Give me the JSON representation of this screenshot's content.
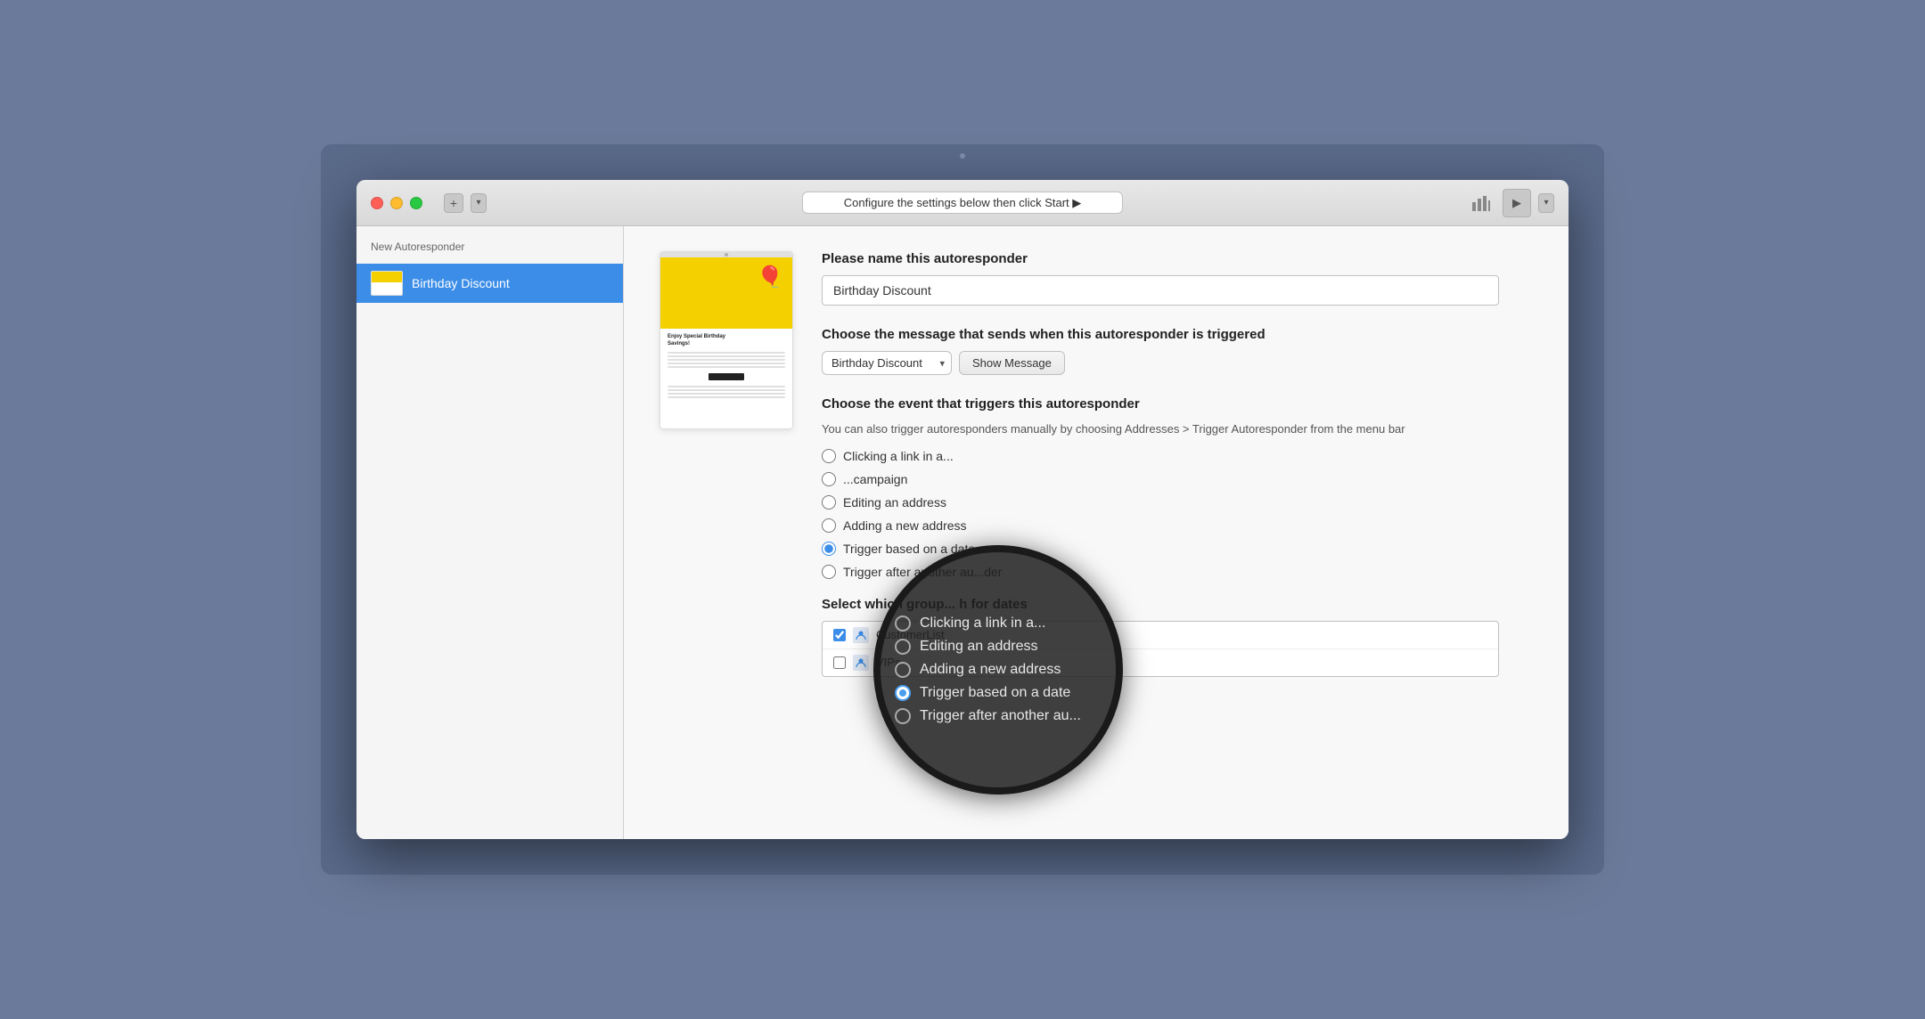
{
  "desktop": {
    "dot_visible": true
  },
  "window": {
    "title_bar": {
      "config_text": "Configure the settings below then click Start ▶",
      "add_btn_label": "+",
      "dropdown_btn_label": "▾",
      "play_btn_label": "▶",
      "dropdown_right_label": "▾"
    },
    "sidebar": {
      "title": "New Autoresponder",
      "items": [
        {
          "id": "birthday-discount",
          "label": "Birthday Discount",
          "active": true
        }
      ]
    },
    "form": {
      "name_label": "Please name this autoresponder",
      "name_value": "Birthday Discount",
      "message_label": "Choose the message that sends when this autoresponder is triggered",
      "message_select_value": "Birthday Discount",
      "show_message_label": "Show Message",
      "trigger_label": "Choose the event that triggers this autoresponder",
      "trigger_desc": "You can also trigger autoresponders manually by choosing Addresses > Trigger\nAutoresponder from the menu bar",
      "radio_options": [
        {
          "id": "r1",
          "label": "Clicking a link in a...",
          "checked": false,
          "partial": true
        },
        {
          "id": "r2",
          "label": "...campaign",
          "checked": false,
          "partial": true
        },
        {
          "id": "r3",
          "label": "Editing an address",
          "checked": false
        },
        {
          "id": "r4",
          "label": "Adding a new address",
          "checked": false
        },
        {
          "id": "r5",
          "label": "Trigger based on a date...",
          "checked": true
        },
        {
          "id": "r6",
          "label": "Trigger after another au...der",
          "checked": false
        }
      ],
      "groups_label": "Select which group... h for dates",
      "groups": [
        {
          "label": "CustomerList",
          "checked": true
        },
        {
          "label": "VIPs",
          "checked": false
        }
      ]
    },
    "magnifier": {
      "items": [
        {
          "label": "Clicking a link in a...",
          "checked": false
        },
        {
          "label": "Editing an address",
          "checked": false
        },
        {
          "label": "Adding a new address",
          "checked": false
        },
        {
          "label": "Trigger based on a date",
          "checked": true
        },
        {
          "label": "Trigger after another au...",
          "checked": false
        }
      ]
    }
  }
}
